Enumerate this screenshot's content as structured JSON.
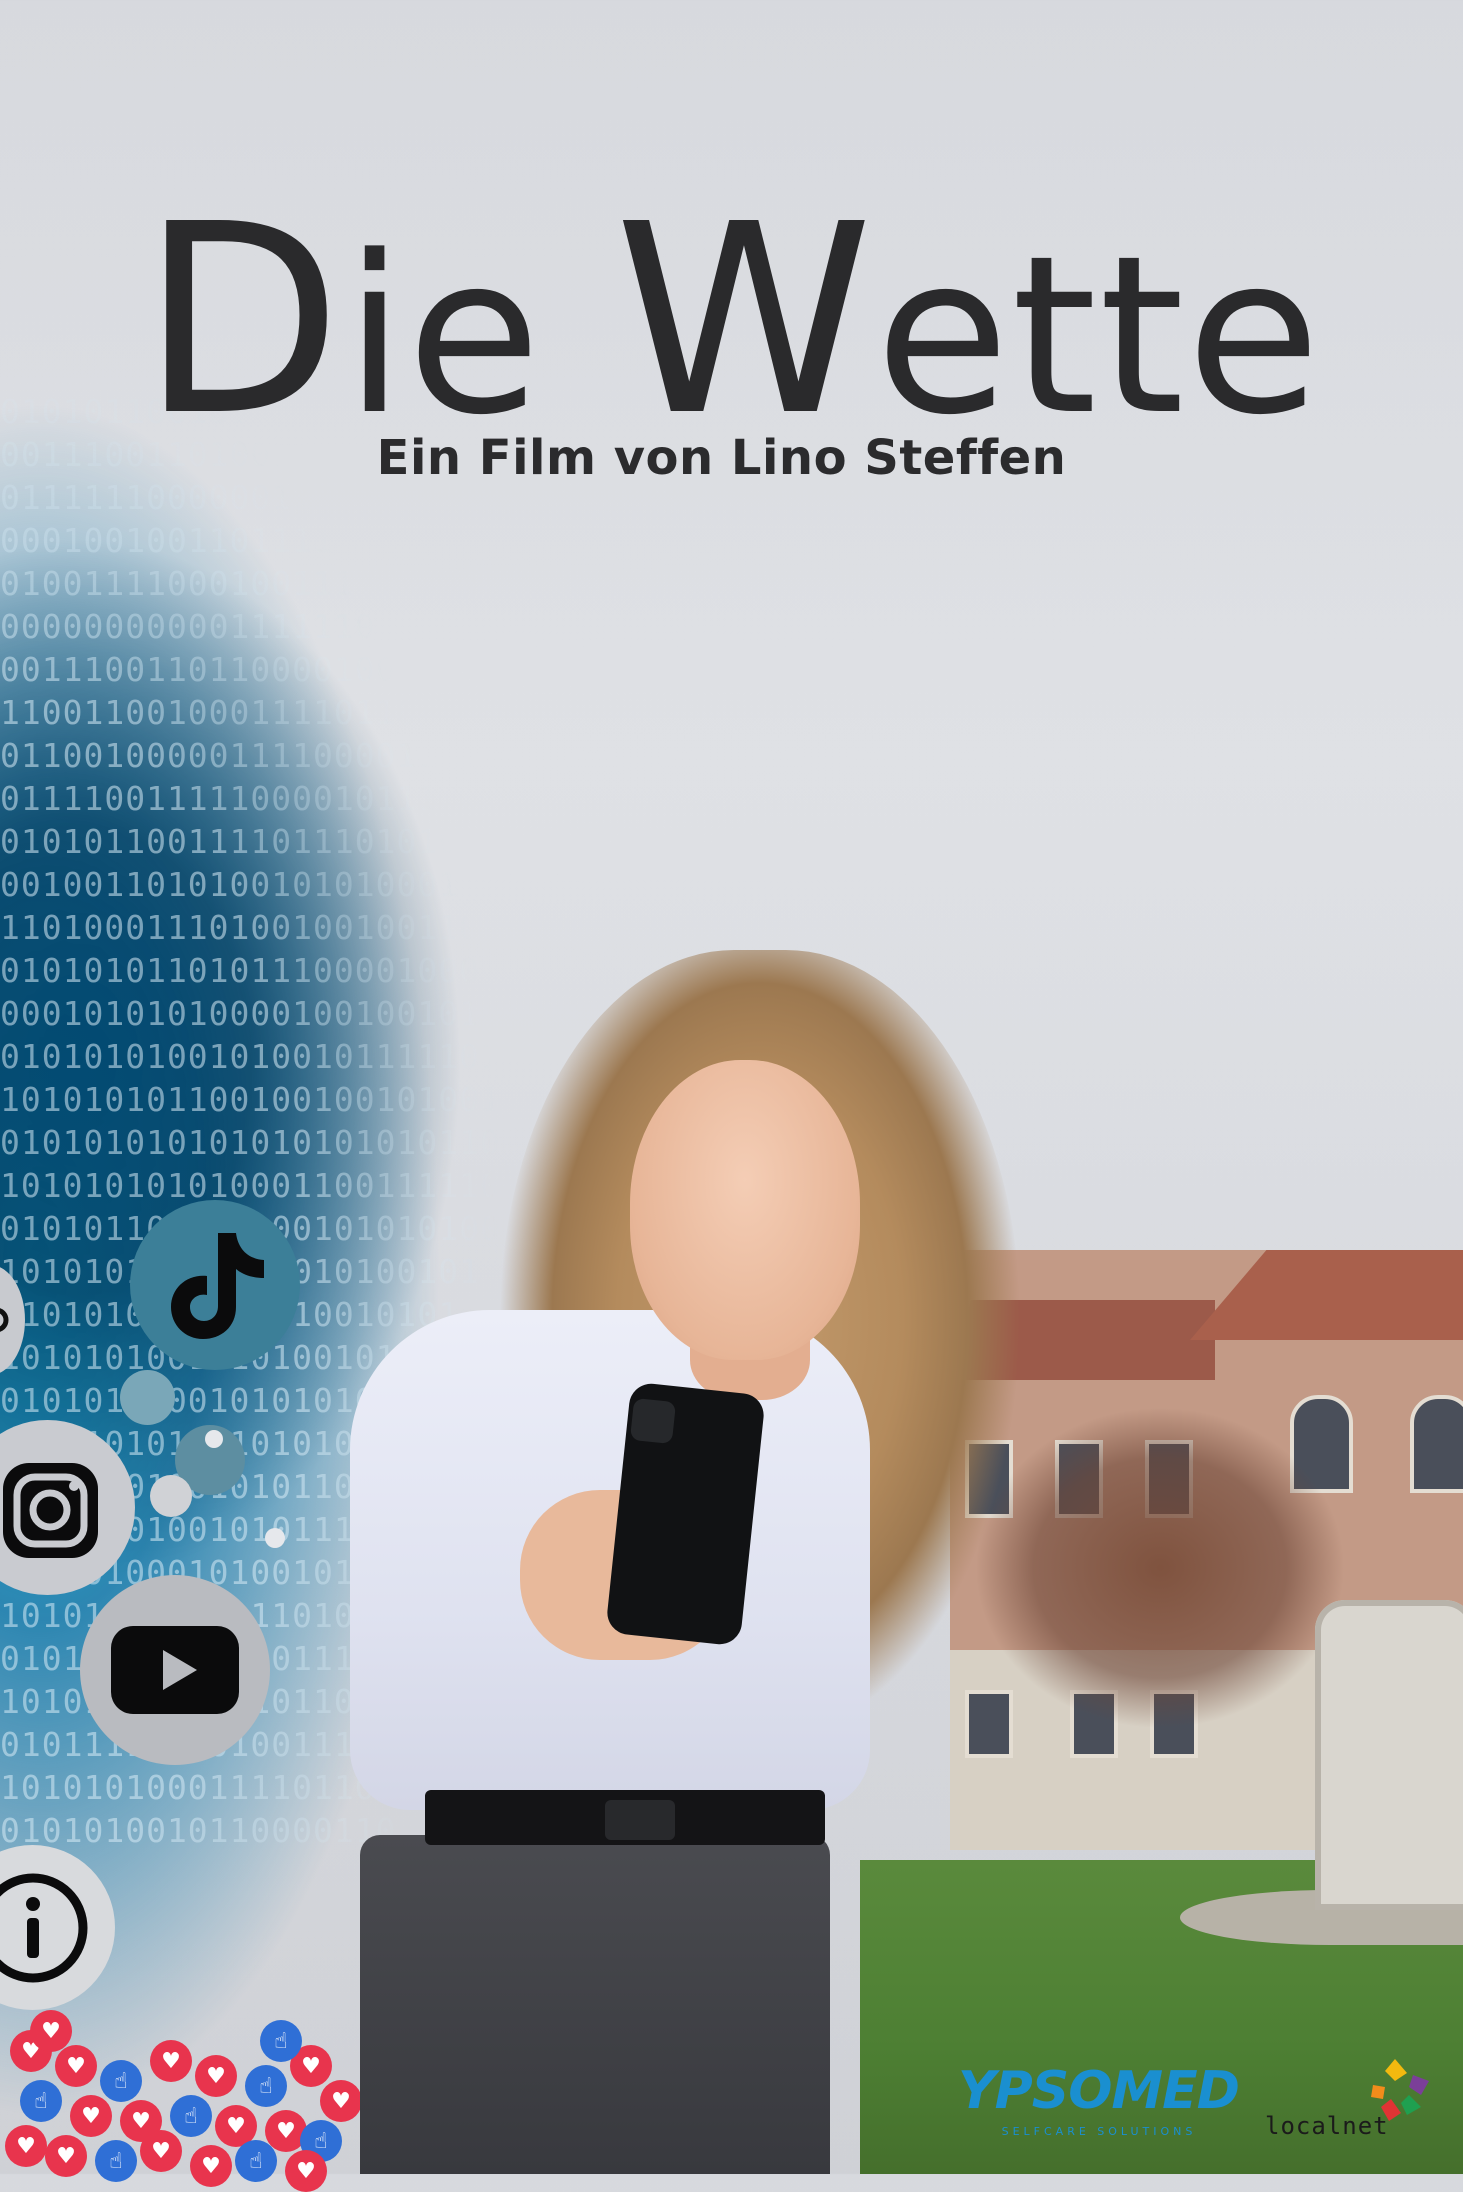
{
  "poster": {
    "title_first_cap": "D",
    "title_first_rest": "ie ",
    "title_second_cap": "W",
    "title_second_rest": "ette",
    "subtitle": "Ein Film von Lino Steffen"
  },
  "binary_lines": [
    "01010110010101",
    "00111001101001",
    "01111110000001110100",
    "0001001001101111110011",
    "01001111000100111011110",
    "00000000000111111010101001",
    "00111001101100001000001000100",
    "11001100100011110110111100001",
    "0110010000011110000110010000010",
    "011110011111000010111001000010",
    "01010110011110111010100101001110",
    "001001101010010101000101110001101",
    "11010001110100100100110010011010",
    "0101010110101110000100000111010",
    "000101010100001001001010111110",
    "010101010010100101111101000",
    "101010101100100100101001000",
    "0101010101010101010101101",
    "1010101010100011001111101",
    "0101011010101001010101001",
    "10101010010101010100101",
    "0101010100101010010101",
    "1010101001010100101010",
    "010101010010101010010",
    "10101010100101010110101",
    "0101010100101011010110",
    "101010010010101110101",
    "01010100010100101100",
    "1010101001011101011101",
    "0101010110011011111101",
    "10101000111010110100",
    "01011110000100111110",
    "101010100011110110111",
    "0101010010110000110"
  ],
  "social_icons": [
    "tiktok-icon",
    "instagram-icon",
    "youtube-icon",
    "info-icon"
  ],
  "reactions": [
    {
      "type": "heart",
      "color": "#e8344d",
      "glyph": "♥"
    },
    {
      "type": "like",
      "color": "#2f6fd6",
      "glyph": "☝"
    }
  ],
  "sponsors": {
    "ypsomed": "YPSOMED",
    "ypsomed_sub": "SELFCARE SOLUTIONS",
    "localnet": "localnet"
  },
  "colors": {
    "title": "#2a2a2c",
    "sky": "#dfe1e5",
    "binary_blue": "#14aad7",
    "ypsomed_blue": "#1a8fd0"
  }
}
